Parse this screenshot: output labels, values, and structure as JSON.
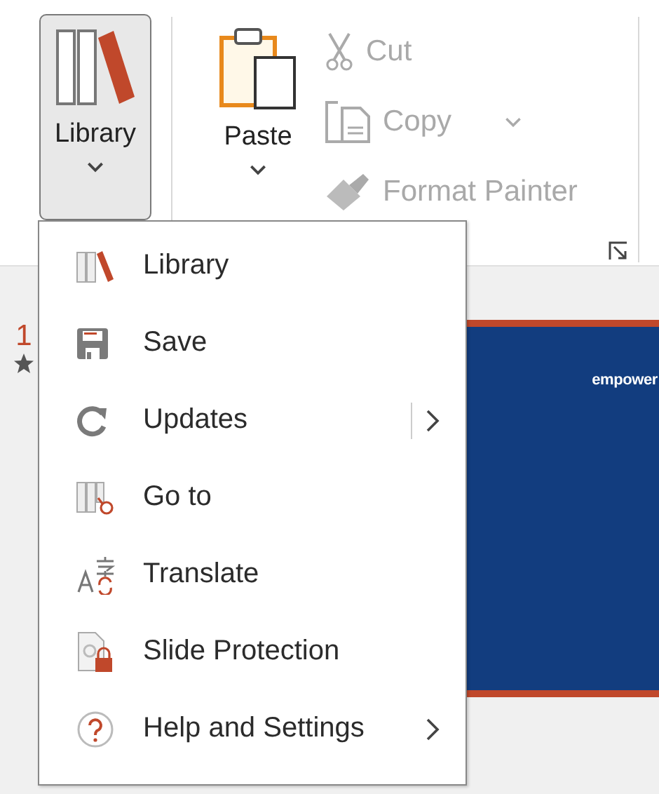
{
  "ribbon": {
    "large_buttons": [
      {
        "kind": "library",
        "label": "Library",
        "pressed": true
      },
      {
        "kind": "paste",
        "label": "Paste",
        "pressed": false
      }
    ],
    "small_buttons": [
      {
        "kind": "cut",
        "label": "Cut",
        "disabled": true,
        "dropdown": false
      },
      {
        "kind": "copy",
        "label": "Copy",
        "disabled": true,
        "dropdown": true
      },
      {
        "kind": "format-painter",
        "label": "Format Painter",
        "disabled": true,
        "dropdown": false
      }
    ]
  },
  "thumbnail": {
    "number": "1",
    "starred": true
  },
  "slide": {
    "text": "empower"
  },
  "menu": {
    "items": [
      {
        "kind": "library",
        "label": "Library",
        "submenu": false,
        "split": false
      },
      {
        "kind": "save",
        "label": "Save",
        "submenu": false,
        "split": false
      },
      {
        "kind": "updates",
        "label": "Updates",
        "submenu": true,
        "split": true
      },
      {
        "kind": "goto",
        "label": "Go to",
        "submenu": false,
        "split": false
      },
      {
        "kind": "translate",
        "label": "Translate",
        "submenu": false,
        "split": false
      },
      {
        "kind": "protection",
        "label": "Slide Protection",
        "submenu": false,
        "split": false
      },
      {
        "kind": "help",
        "label": "Help and Settings",
        "submenu": true,
        "split": false
      }
    ]
  }
}
